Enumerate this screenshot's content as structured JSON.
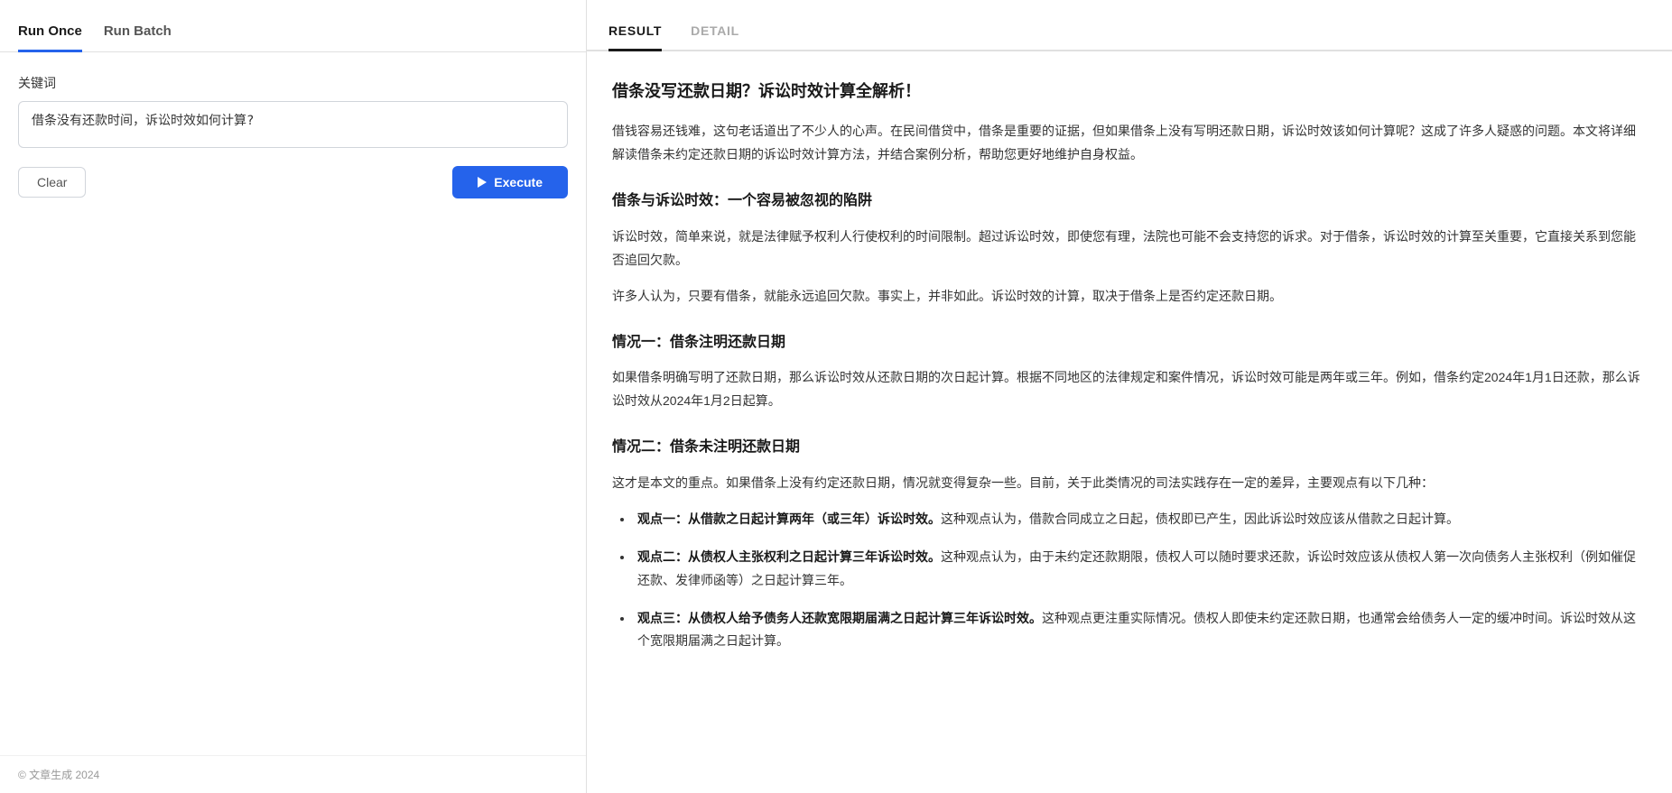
{
  "left": {
    "tabs": [
      {
        "id": "run-once",
        "label": "Run Once",
        "active": true
      },
      {
        "id": "run-batch",
        "label": "Run Batch",
        "active": false
      }
    ],
    "field_label": "关键词",
    "input_value": "借条没有还款时间，诉讼时效如何计算?",
    "input_placeholder": "借条没有还款时间，诉讼时效如何计算?",
    "clear_label": "Clear",
    "execute_label": "Execute",
    "footer": "© 文章生成 2024"
  },
  "right": {
    "tabs": [
      {
        "id": "result",
        "label": "RESULT",
        "active": true
      },
      {
        "id": "detail",
        "label": "DETAIL",
        "active": false
      }
    ],
    "article": {
      "title": "借条没写还款日期？诉讼时效计算全解析！",
      "intro": "借钱容易还钱难，这句老话道出了不少人的心声。在民间借贷中，借条是重要的证据，但如果借条上没有写明还款日期，诉讼时效该如何计算呢？这成了许多人疑惑的问题。本文将详细解读借条未约定还款日期的诉讼时效计算方法，并结合案例分析，帮助您更好地维护自身权益。",
      "section1_title": "借条与诉讼时效：一个容易被忽视的陷阱",
      "section1_p1": "诉讼时效，简单来说，就是法律赋予权利人行使权利的时间限制。超过诉讼时效，即使您有理，法院也可能不会支持您的诉求。对于借条，诉讼时效的计算至关重要，它直接关系到您能否追回欠款。",
      "section1_p2": "许多人认为，只要有借条，就能永远追回欠款。事实上，并非如此。诉讼时效的计算，取决于借条上是否约定还款日期。",
      "section2_title": "情况一：借条注明还款日期",
      "section2_p1": "如果借条明确写明了还款日期，那么诉讼时效从还款日期的次日起计算。根据不同地区的法律规定和案件情况，诉讼时效可能是两年或三年。例如，借条约定2024年1月1日还款，那么诉讼时效从2024年1月2日起算。",
      "section3_title": "情况二：借条未注明还款日期",
      "section3_intro": "这才是本文的重点。如果借条上没有约定还款日期，情况就变得复杂一些。目前，关于此类情况的司法实践存在一定的差异，主要观点有以下几种：",
      "viewpoints": [
        {
          "bold": "观点一：从借款之日起计算两年（或三年）诉讼时效。",
          "text": "这种观点认为，借款合同成立之日起，债权即已产生，因此诉讼时效应该从借款之日起计算。"
        },
        {
          "bold": "观点二：从债权人主张权利之日起计算三年诉讼时效。",
          "text": "这种观点认为，由于未约定还款期限，债权人可以随时要求还款，诉讼时效应该从债权人第一次向债务人主张权利（例如催促还款、发律师函等）之日起计算三年。"
        },
        {
          "bold": "观点三：从债权人给予债务人还款宽限期届满之日起计算三年诉讼时效。",
          "text": "这种观点更注重实际情况。债权人即使未约定还款日期，也通常会给债务人一定的缓冲时间。诉讼时效从这个宽限期届满之日起计算。"
        }
      ]
    }
  }
}
